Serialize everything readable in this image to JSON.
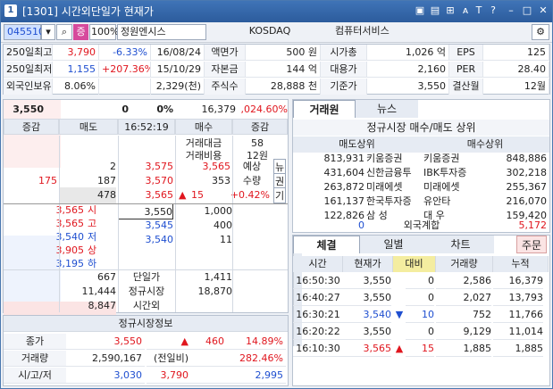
{
  "window": {
    "num": "1",
    "title": "[1301] 시간외단일가 현재가",
    "icons": [
      "settings-icon",
      "save-icon",
      "lock-icon",
      "font-icon",
      "help-icon",
      "minimize-icon",
      "maximize-icon",
      "close-icon"
    ],
    "icon_glyphs": [
      "▣",
      "▤",
      "⊞",
      "ᴀ",
      "T",
      "?",
      "–",
      "□",
      "✕"
    ]
  },
  "toolbar": {
    "code": "045510",
    "flag": "증",
    "pct": "100%",
    "name": "정원엔시스",
    "market": "KOSDAQ",
    "sector": "컴퓨터서비스"
  },
  "summary": [
    [
      "250일최고",
      "3,790",
      "-6.33%",
      "16/08/24",
      "액면가",
      "500 원",
      "시가총",
      "1,026 억",
      "EPS",
      "125"
    ],
    [
      "250일최저",
      "1,155",
      "+207.36%",
      "15/10/29",
      "자본금",
      "144 억",
      "대용가",
      "2,160",
      "PER",
      "28.40"
    ],
    [
      "외국인보유",
      "8.06%",
      "",
      "2,329(천)",
      "주식수",
      "28,888 천",
      "기준가",
      "3,550",
      "결산월",
      "12월"
    ]
  ],
  "quote": {
    "price": "3,550",
    "chg": "0",
    "pct": "0%",
    "vol": "16,379",
    "amt": ",024.60%"
  },
  "ob_header": [
    "증감",
    "매도",
    "16:52:19",
    "매수",
    "증감"
  ],
  "ob_sell": [
    {
      "chg": "",
      "qty": "2",
      "price": "3,575"
    },
    {
      "chg": "175",
      "qty": "187",
      "price": "3,570"
    },
    {
      "chg": "",
      "qty": "478",
      "price": "3,565"
    }
  ],
  "ob_right_top": [
    [
      "거래대금",
      "58"
    ],
    [
      "거래비용",
      "12원"
    ]
  ],
  "expect": {
    "price": "3,565",
    "label1": "예상",
    "qty": "353",
    "label2": "수량",
    "arrow": "▲",
    "diff": "15",
    "pct": "+0.42%",
    "side": [
      "뉴",
      "권",
      "기"
    ]
  },
  "ob_left_info": [
    [
      "3,565",
      "시"
    ],
    [
      "3,565",
      "고"
    ],
    [
      "3,540",
      "저"
    ],
    [
      "3,905",
      "상"
    ],
    [
      "3,195",
      "하"
    ]
  ],
  "ob_buy": [
    {
      "price": "3,550",
      "qty": "1,000"
    },
    {
      "price": "3,545",
      "qty": "400"
    },
    {
      "price": "3,540",
      "qty": "11"
    }
  ],
  "ob_totals": [
    [
      "667",
      "단일가",
      "1,411"
    ],
    [
      "11,444",
      "정규시장",
      "18,870"
    ],
    [
      "8,847",
      "시간외",
      ""
    ]
  ],
  "regular": {
    "title": "정규시장정보",
    "rows": [
      [
        "종가",
        "3,550",
        "▲",
        "460",
        "14.89%"
      ],
      [
        "거래량",
        "2,590,167",
        "(전일비)",
        "",
        "282.46%"
      ],
      [
        "시/고/저",
        "3,030",
        "3,790",
        "",
        "2,995"
      ]
    ]
  },
  "broker": {
    "tabs": [
      "거래원",
      "뉴스"
    ],
    "title": "정규시장 매수/매도 상위",
    "sell_hdr": "매도상위",
    "buy_hdr": "매수상위",
    "rows": [
      [
        "813,931",
        "키움증권",
        "키움증권",
        "848,886"
      ],
      [
        "431,604",
        "신한금융투",
        "IBK투자증",
        "302,218"
      ],
      [
        "263,872",
        "미래에셋",
        "미래에셋",
        "255,367"
      ],
      [
        "161,137",
        "한국투자증",
        "유안타",
        "216,070"
      ],
      [
        "122,826",
        "삼  성",
        "대  우",
        "159,420"
      ]
    ],
    "foreign": [
      "0",
      "외국계합",
      "5,172"
    ]
  },
  "trade": {
    "tabs": [
      "체결",
      "일별",
      "차트",
      "주문"
    ],
    "headers": [
      "시간",
      "현재가",
      "대비",
      "거래량",
      "누적"
    ],
    "rows": [
      [
        "16:50:30",
        "3,550",
        "",
        "0",
        "2,586",
        "16,379"
      ],
      [
        "16:40:27",
        "3,550",
        "",
        "0",
        "2,027",
        "13,793"
      ],
      [
        "16:30:21",
        "3,540",
        "▼",
        "10",
        "752",
        "11,766"
      ],
      [
        "16:20:22",
        "3,550",
        "",
        "0",
        "9,129",
        "11,014"
      ],
      [
        "16:10:30",
        "3,565",
        "▲",
        "15",
        "1,885",
        "1,885"
      ]
    ]
  }
}
